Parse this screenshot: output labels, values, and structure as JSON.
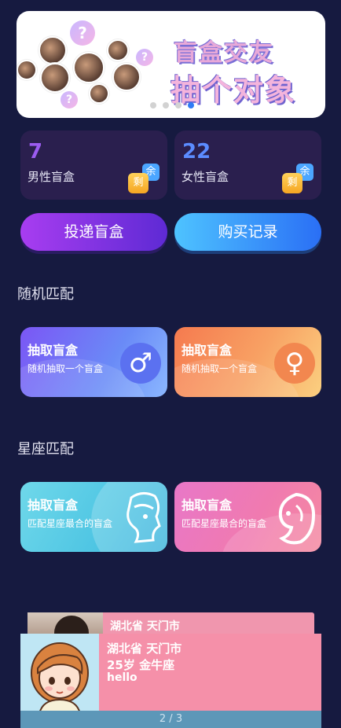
{
  "banner": {
    "title_line1": "盲盒交友",
    "title_line2": "抽个对象",
    "question_mark": "?",
    "pagination_dots": 4,
    "active_dot": 4
  },
  "stats": {
    "male": {
      "count": "7",
      "label": "男性盲盒",
      "badge_top": "余",
      "badge_bottom": "剩",
      "color": "#9b5cf0"
    },
    "female": {
      "count": "22",
      "label": "女性盲盒",
      "badge_top": "余",
      "badge_bottom": "剩",
      "color": "#5b8cff"
    }
  },
  "actions": {
    "deliver_label": "投递盲盒",
    "purchase_label": "购买记录"
  },
  "random_match": {
    "section_title": "随机匹配",
    "male_card": {
      "title": "抽取盲盒",
      "subtitle": "随机抽取一个盲盒",
      "icon": "♂"
    },
    "female_card": {
      "title": "抽取盲盒",
      "subtitle": "随机抽取一个盲盒",
      "icon": "♀"
    }
  },
  "zodiac_match": {
    "section_title": "星座匹配",
    "male_card": {
      "title": "抽取盲盒",
      "subtitle": "匹配星座最合的盲盒"
    },
    "female_card": {
      "title": "抽取盲盒",
      "subtitle": "匹配星座最合的盲盒"
    }
  },
  "profile_stack": {
    "back_card_location": "湖北省 天门市",
    "front_card": {
      "location": "湖北省 天门市",
      "age_sign": "25岁 金牛座",
      "bio": "hello"
    },
    "pager": "2 / 3"
  }
}
